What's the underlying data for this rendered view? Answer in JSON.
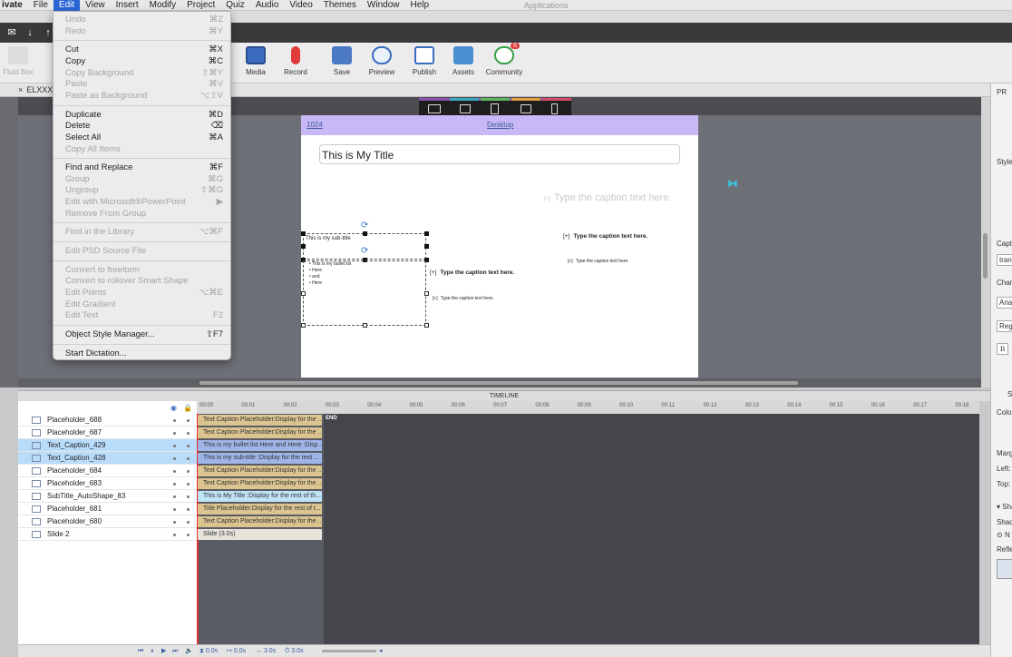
{
  "menubar": {
    "app": "ivate",
    "items": [
      "File",
      "Edit",
      "View",
      "Insert",
      "Modify",
      "Project",
      "Quiz",
      "Audio",
      "Video",
      "Themes",
      "Window",
      "Help"
    ],
    "window_title": "Applications"
  },
  "toolbar": {
    "fluid_box": "Fluid Box",
    "media": "Media",
    "record": "Record",
    "save": "Save",
    "preview": "Preview",
    "publish": "Publish",
    "assets": "Assets",
    "community": "Community",
    "community_badge": "6"
  },
  "tabs": {
    "file": "ELXXX"
  },
  "breakpoint": {
    "width": "1024",
    "mode": "Desktop"
  },
  "slide": {
    "title": "This is My Title",
    "subtitle": "This is my sub-title",
    "bullet_title": "This is my bullet list",
    "bullets": [
      "Here",
      "and",
      "Here"
    ],
    "caption_large": "Type the caption text here.",
    "caption_bold": "Type the caption text here.",
    "caption_small": "Type the caption text here.",
    "caption_bold2": "Type the caption text here.",
    "caption_small2": "Type the caption text here."
  },
  "edit_menu": [
    {
      "label": "Undo",
      "shortcut": "⌘Z",
      "enabled": false
    },
    {
      "label": "Redo",
      "shortcut": "⌘Y",
      "enabled": false
    },
    {
      "sep": true
    },
    {
      "label": "Cut",
      "shortcut": "⌘X",
      "enabled": true
    },
    {
      "label": "Copy",
      "shortcut": "⌘C",
      "enabled": true
    },
    {
      "label": "Copy Background",
      "shortcut": "⇧⌘Y",
      "enabled": false
    },
    {
      "label": "Paste",
      "shortcut": "⌘V",
      "enabled": false
    },
    {
      "label": "Paste as Background",
      "shortcut": "⌥⇧V",
      "enabled": false
    },
    {
      "sep": true
    },
    {
      "label": "Duplicate",
      "shortcut": "⌘D",
      "enabled": true
    },
    {
      "label": "Delete",
      "shortcut": "⌫",
      "enabled": true
    },
    {
      "label": "Select All",
      "shortcut": "⌘A",
      "enabled": true
    },
    {
      "label": "Copy All Items",
      "shortcut": "",
      "enabled": false
    },
    {
      "sep": true
    },
    {
      "label": "Find and Replace",
      "shortcut": "⌘F",
      "enabled": true
    },
    {
      "label": "Group",
      "shortcut": "⌘G",
      "enabled": false
    },
    {
      "label": "Ungroup",
      "shortcut": "⇧⌘G",
      "enabled": false
    },
    {
      "label": "Edit with Microsoft®PowerPoint",
      "shortcut": "▶",
      "enabled": false
    },
    {
      "label": "Remove From Group",
      "shortcut": "",
      "enabled": false
    },
    {
      "sep": true
    },
    {
      "label": "Find in the Library",
      "shortcut": "⌥⌘F",
      "enabled": false
    },
    {
      "sep": true
    },
    {
      "label": "Edit PSD Source File",
      "shortcut": "",
      "enabled": false
    },
    {
      "sep": true
    },
    {
      "label": "Convert to freeform",
      "shortcut": "",
      "enabled": false
    },
    {
      "label": "Convert to rollover Smart Shape",
      "shortcut": "",
      "enabled": false
    },
    {
      "label": "Edit Points",
      "shortcut": "⌥⌘E",
      "enabled": false
    },
    {
      "label": "Edit Gradient",
      "shortcut": "",
      "enabled": false
    },
    {
      "label": "Edit Text",
      "shortcut": "F2",
      "enabled": false
    },
    {
      "sep": true
    },
    {
      "label": "Object Style Manager...",
      "shortcut": "⇧F7",
      "enabled": true
    },
    {
      "sep": true
    },
    {
      "label": "Start Dictation...",
      "shortcut": "",
      "enabled": true
    }
  ],
  "timeline": {
    "header": "TIMELINE",
    "ticks": [
      "00:00",
      "00:01",
      "00:02",
      "00:03",
      "00:04",
      "00:05",
      "00:06",
      "00:07",
      "00:08",
      "00:09",
      "00:10",
      "00:11",
      "00:12",
      "00:13",
      "00:14",
      "00:15",
      "00:16",
      "00:17",
      "00:18"
    ],
    "end_label": "END",
    "rows": [
      {
        "name": "Placeholder_688",
        "bar": "Text Caption Placeholder:Display for the ...",
        "highlight": false,
        "bar_color": "#dcc491"
      },
      {
        "name": "Placeholder_687",
        "bar": "Text Caption Placeholder:Display for the ...",
        "highlight": false,
        "bar_color": "#dcc491"
      },
      {
        "name": "Text_Caption_429",
        "bar": "This is my bullet list Here and Here :Disp...",
        "highlight": true,
        "bar_color": "#9fb5e8"
      },
      {
        "name": "Text_Caption_428",
        "bar": "This is my sub-title :Display for the rest ...",
        "highlight": true,
        "bar_color": "#9fb5e8"
      },
      {
        "name": "Placeholder_684",
        "bar": "Text Caption Placeholder:Display for the ...",
        "highlight": false,
        "bar_color": "#dcc491"
      },
      {
        "name": "Placeholder_683",
        "bar": "Text Caption Placeholder:Display for the ...",
        "highlight": false,
        "bar_color": "#dcc491"
      },
      {
        "name": "SubTitle_AutoShape_83",
        "bar": "This is My Title :Display for the rest of th...",
        "highlight": false,
        "bar_color": "#bfe3f7"
      },
      {
        "name": "Placeholder_681",
        "bar": "Title Placeholder:Display for the rest of t...",
        "highlight": false,
        "bar_color": "#dcc491"
      },
      {
        "name": "Placeholder_680",
        "bar": "Text Caption Placeholder:Display for the ...",
        "highlight": false,
        "bar_color": "#dcc491"
      },
      {
        "name": "Slide 2",
        "bar": "Slide (3.0s)",
        "highlight": false,
        "bar_color": "#e6e3da"
      }
    ],
    "controls": {
      "t1": "0.0s",
      "t2": "0.0s",
      "t3": "3.0s",
      "t4": "3.0s"
    }
  },
  "right_panel": [
    "PR",
    "Style",
    "Capti",
    "tran",
    "Chara",
    "Aria",
    "Regu",
    "B",
    "S",
    "Colo",
    "Marg",
    "Left:",
    "Top:",
    "▾ Sha",
    "Shad",
    "N",
    "Refle"
  ],
  "colors": {
    "menu_highlight": "#2b66d6",
    "breakpoint_bar": "#c8b8f5",
    "record_red": "#e03a3a",
    "timeline_bg": "#45464b"
  }
}
